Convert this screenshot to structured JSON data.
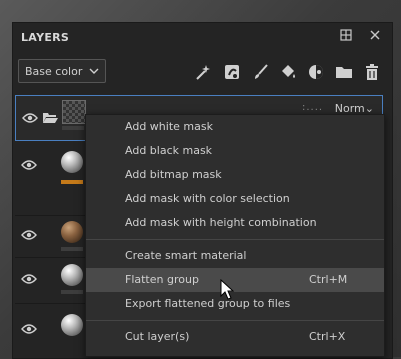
{
  "panel": {
    "title": "LAYERS"
  },
  "toolbar": {
    "channel_dropdown": "Base color",
    "icons": [
      "magic-wand-icon",
      "effect-icon",
      "brush-icon",
      "fill-bucket-icon",
      "mask-icon",
      "folder-icon",
      "trash-icon"
    ]
  },
  "layers": {
    "selected_blend": "Norm",
    "rows": [
      {
        "type": "group"
      },
      {
        "type": "fill",
        "color": "#c57a1a"
      },
      {
        "type": "material"
      },
      {
        "type": "fill"
      },
      {
        "type": "fill"
      }
    ]
  },
  "context_menu": {
    "items": [
      {
        "label": "Add white mask",
        "shortcut": ""
      },
      {
        "label": "Add black mask",
        "shortcut": ""
      },
      {
        "label": "Add bitmap mask",
        "shortcut": ""
      },
      {
        "label": "Add mask with color selection",
        "shortcut": ""
      },
      {
        "label": "Add mask with height combination",
        "shortcut": ""
      },
      {
        "label": "Create smart material",
        "shortcut": ""
      },
      {
        "label": "Flatten group",
        "shortcut": "Ctrl+M"
      },
      {
        "label": "Export flattened group to files",
        "shortcut": ""
      },
      {
        "label": "Cut layer(s)",
        "shortcut": "Ctrl+X"
      }
    ]
  },
  "colors": {
    "accent": "#4a7fc0",
    "highlight": "#4a4a4a",
    "orange_bar": "#c57a1a"
  }
}
